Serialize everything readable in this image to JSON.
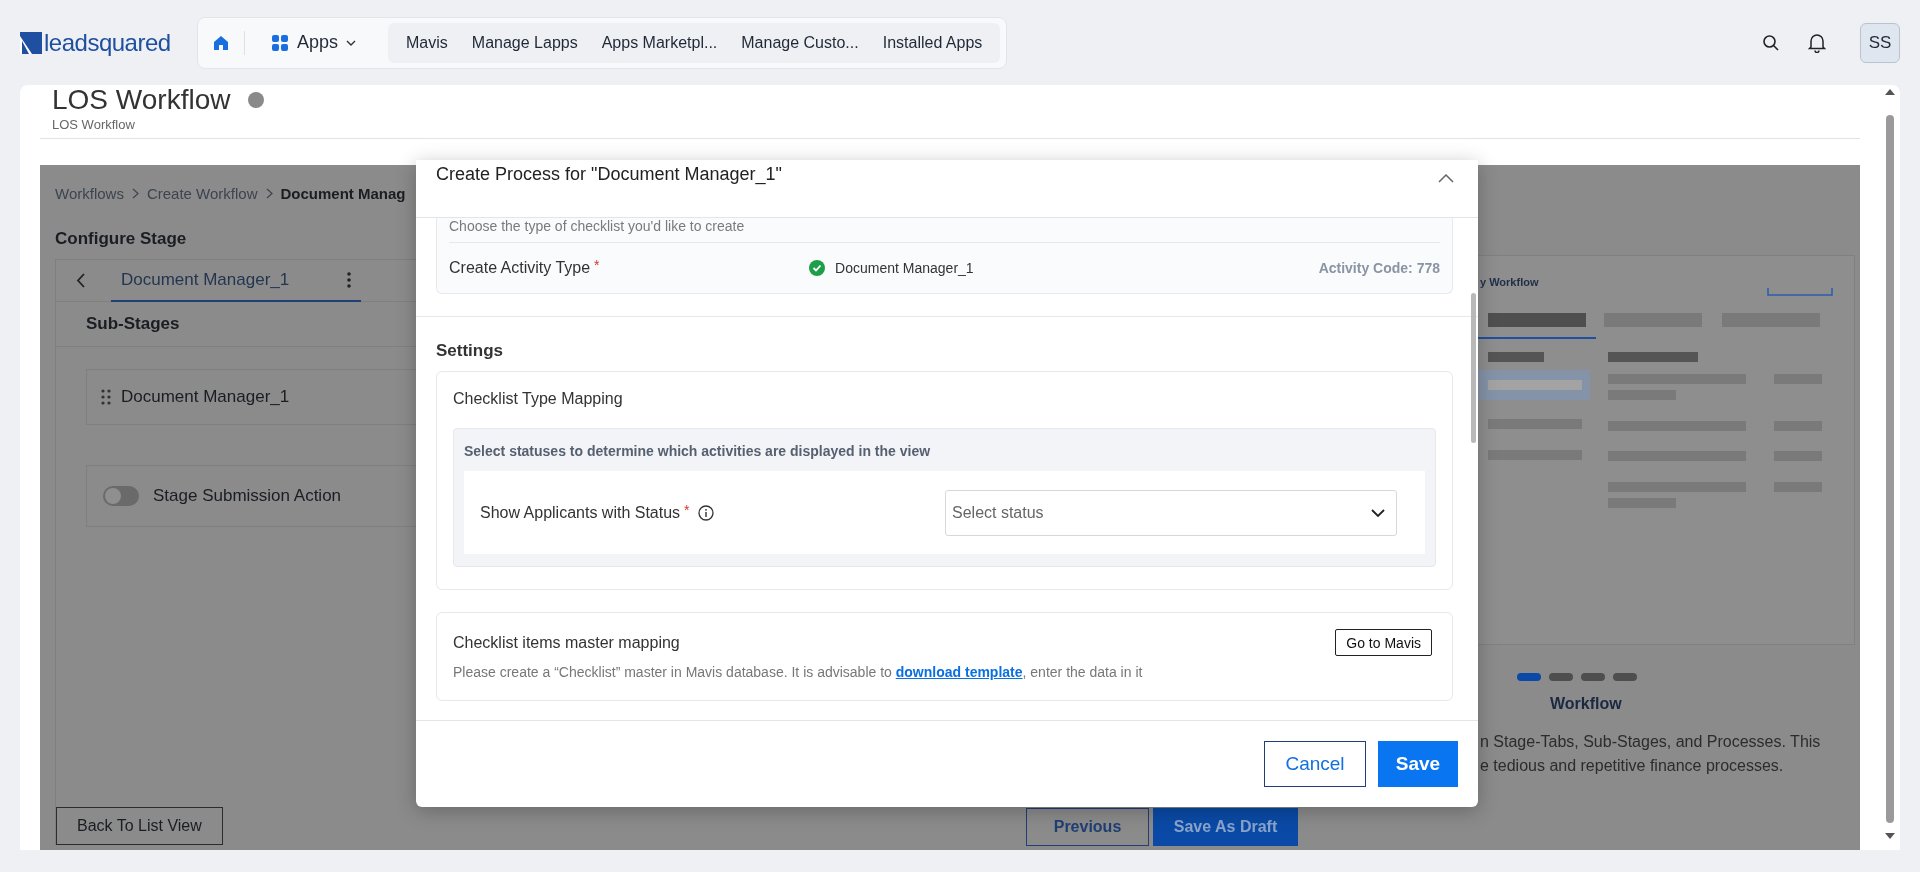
{
  "topbar": {
    "logo": "leadsquared",
    "apps_label": "Apps",
    "tabs": [
      {
        "label": "Mavis",
        "selected": false
      },
      {
        "label": "Manage Lapps",
        "selected": false
      },
      {
        "label": "Apps Marketpl...",
        "selected": false
      },
      {
        "label": "Manage Custo...",
        "selected": false
      },
      {
        "label": "Installed Apps",
        "selected": false
      }
    ],
    "avatar": "SS"
  },
  "page": {
    "title": "LOS Workflow",
    "subtitle": "LOS Workflow"
  },
  "stage_panel": {
    "breadcrumb": [
      {
        "label": "Workflows",
        "current": false
      },
      {
        "label": "Create Workflow",
        "current": false
      },
      {
        "label": "Document Manag",
        "current": true
      }
    ],
    "heading": "Configure Stage",
    "stage_tabs": [
      {
        "label": "Document Manager_1",
        "selected": true
      }
    ],
    "substages_heading": "Sub-Stages",
    "substages": [
      {
        "label": "Document Manager_1"
      }
    ],
    "submission_toggle": {
      "label": "Stage Submission Action",
      "on": false
    },
    "back_button": "Back To List View"
  },
  "footer_buttons": {
    "previous": "Previous",
    "save_draft": "Save As Draft"
  },
  "preview": {
    "title": "y Workflow",
    "dots": [
      {
        "selected": true
      },
      {
        "selected": false
      },
      {
        "selected": false
      },
      {
        "selected": false
      }
    ],
    "heading": "Workflow",
    "description_lines": [
      "n Stage-Tabs, Sub-Stages, and Processes. This",
      "e tedious and repetitive finance processes."
    ]
  },
  "modal": {
    "title": "Create Process for \"Document Manager_1\"",
    "activity_hint": "Choose the type of checklist you'd like to create",
    "activity_row": {
      "label": "Create Activity Type",
      "required": "*",
      "value": "Document Manager_1",
      "code": "Activity Code: 778"
    },
    "settings_heading": "Settings",
    "type_mapping": {
      "title": "Checklist Type Mapping",
      "hint": "Select statuses to determine which activities are displayed in the view",
      "field": {
        "label": "Show Applicants with Status",
        "required": "*",
        "placeholder": "Select status"
      }
    },
    "master_mapping": {
      "title": "Checklist items master mapping",
      "button": "Go to Mavis",
      "text_before": "Please create a “Checklist” master in Mavis database. It is advisable to ",
      "link": "download template",
      "text_after": ", enter the data in it"
    },
    "buttons": {
      "cancel": "Cancel",
      "save": "Save"
    }
  }
}
